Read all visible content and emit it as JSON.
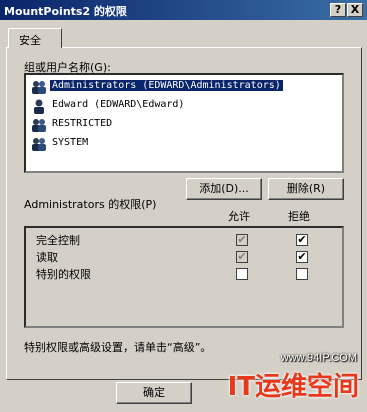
{
  "window": {
    "title": "MountPoints2 的权限",
    "help_btn": "?",
    "close_btn": "X"
  },
  "tab": {
    "label": "安全"
  },
  "users": {
    "label": "组或用户名称(G):",
    "items": [
      {
        "name": "Administrators (EDWARD\\Administrators)",
        "icon": "user-group-icon",
        "selected": true
      },
      {
        "name": "Edward (EDWARD\\Edward)",
        "icon": "user-icon",
        "selected": false
      },
      {
        "name": "RESTRICTED",
        "icon": "user-group-icon",
        "selected": false
      },
      {
        "name": "SYSTEM",
        "icon": "user-group-icon",
        "selected": false
      }
    ]
  },
  "buttons": {
    "add": "添加(D)...",
    "remove": "删除(R)",
    "ok": "确定"
  },
  "permissions": {
    "label": "Administrators 的权限(P)",
    "allow_header": "允许",
    "deny_header": "拒绝",
    "rows": [
      {
        "name": "完全控制",
        "allow": "checked-gray",
        "deny": "checked"
      },
      {
        "name": "读取",
        "allow": "checked-gray",
        "deny": "checked"
      },
      {
        "name": "特别的权限",
        "allow": "unchecked",
        "deny": "unchecked"
      }
    ]
  },
  "advanced_hint": "特别权限或高级设置，请单击“高级”。",
  "watermark": {
    "url": "www.94IP.COM",
    "brand": "IT运维空间"
  },
  "colors": {
    "title_bar": "#0a246a",
    "selection": "#0a246a",
    "face": "#d4d0c8",
    "watermark_red": "#e8381b"
  }
}
